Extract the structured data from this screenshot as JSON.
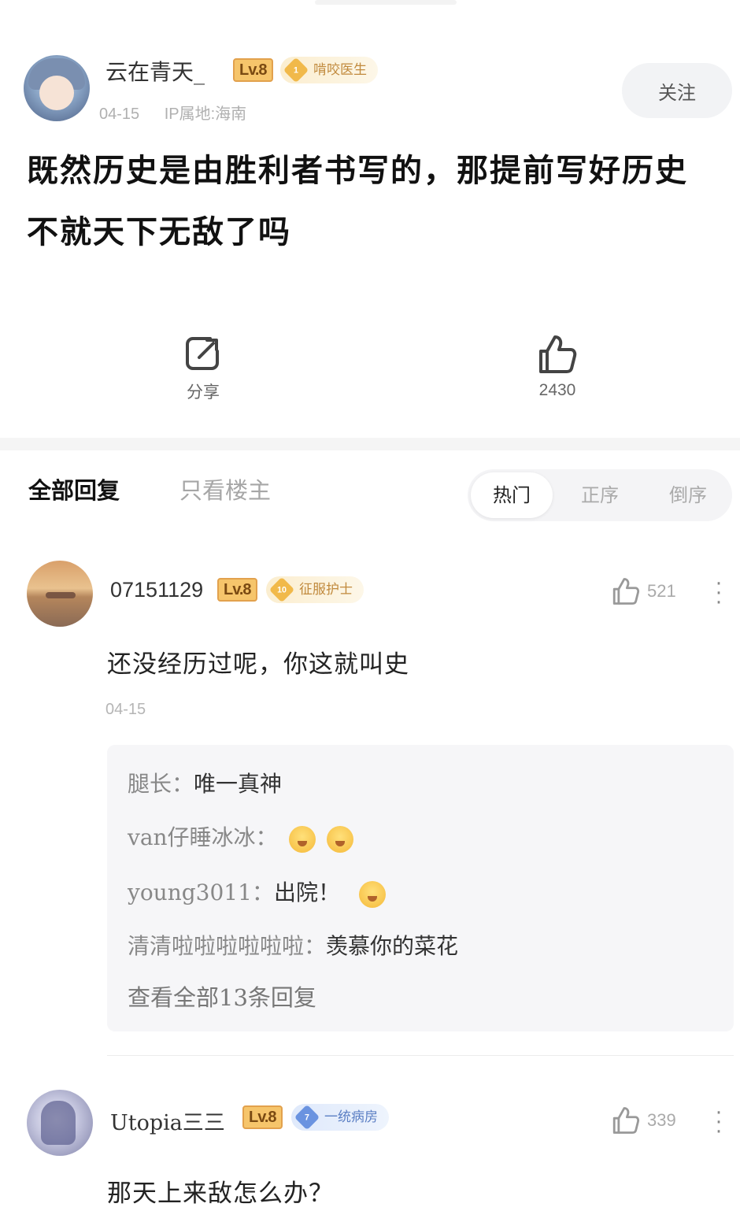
{
  "post": {
    "author": "云在青天_",
    "level": "Lv.8",
    "badge": {
      "num": "1",
      "text": "啃咬医生"
    },
    "date": "04-15",
    "ip": "IP属地:海南",
    "follow_label": "关注",
    "title": "既然历史是由胜利者书写的，那提前写好历史不就天下无敌了吗"
  },
  "actions": {
    "share_label": "分享",
    "like_count": "2430"
  },
  "filter": {
    "all_label": "全部回复",
    "op_only_label": "只看楼主",
    "sort_options": [
      "热门",
      "正序",
      "倒序"
    ],
    "selected_sort": "热门"
  },
  "comments": [
    {
      "user": "07151129",
      "level": "Lv.8",
      "badge": {
        "num": "10",
        "text": "征服护士"
      },
      "likes": "521",
      "text": "还没经历过呢，你这就叫史",
      "date": "04-15",
      "replies": [
        {
          "user": "腿长：",
          "text": "唯一真神"
        },
        {
          "user": "van仔睡冰冰：",
          "text": ""
        },
        {
          "user": "young3011：",
          "text": "出院！"
        },
        {
          "user": "清清啦啦啦啦啦啦：",
          "text": "羡慕你的菜花"
        }
      ],
      "view_all": "查看全部13条回复"
    },
    {
      "user": "Utopia三三",
      "level": "Lv.8",
      "badge": {
        "num": "7",
        "text": "一统病房"
      },
      "likes": "339",
      "text": "那天上来敌怎么办？"
    }
  ],
  "colors": {
    "level_badge": "#f6c56b",
    "gold_badge_text": "#c18a3d",
    "blue_badge_text": "#5b7fc4",
    "muted_text": "#aaaaaa"
  },
  "icons": {
    "share": "share-icon",
    "like": "thumbs-up-icon",
    "more": "more-vertical-icon",
    "reaction_emoji": "grinning-emoji"
  }
}
